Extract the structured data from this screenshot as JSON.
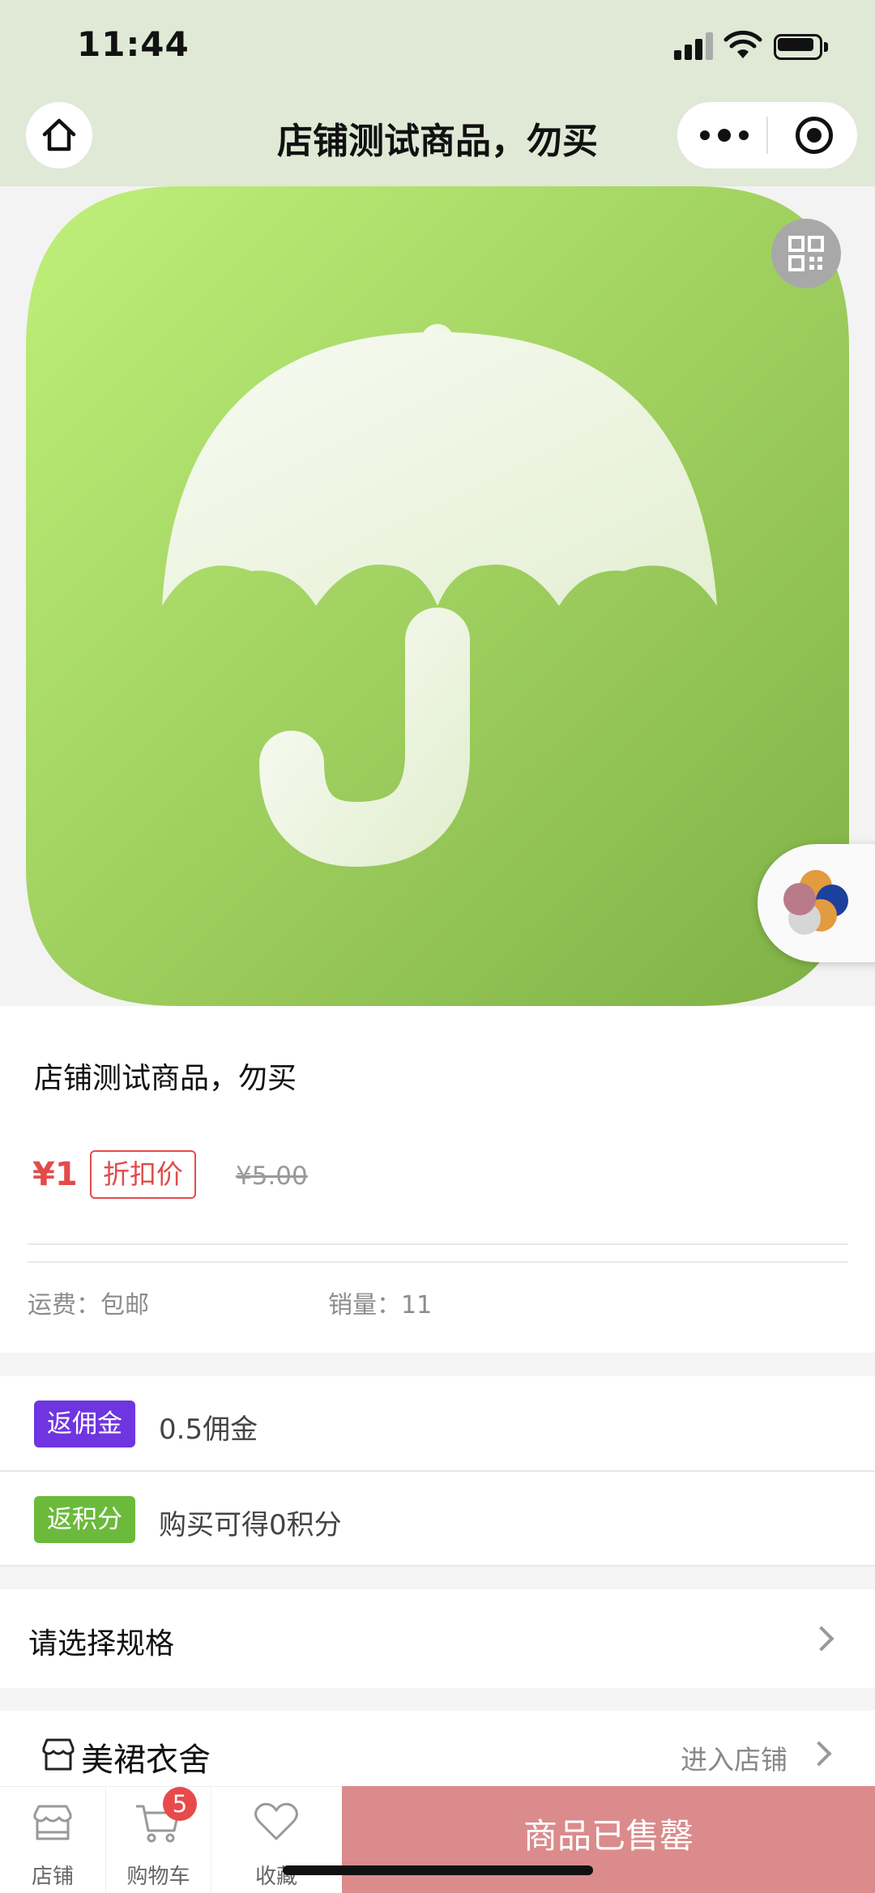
{
  "status_bar": {
    "time": "11:44"
  },
  "nav": {
    "title": "店铺测试商品，勿买"
  },
  "product": {
    "name": "店铺测试商品，勿买",
    "price": "¥1",
    "discount_label": "折扣价",
    "original_price": "¥5.00",
    "shipping": "运费：包邮",
    "sales": "销量：11"
  },
  "rebates": [
    {
      "tag": "返佣金",
      "text": "0.5佣金",
      "color": "#6f35e0"
    },
    {
      "tag": "返积分",
      "text": "购买可得0积分",
      "color": "#6cba3c"
    }
  ],
  "spec": {
    "label": "请选择规格"
  },
  "shop": {
    "name": "美裙衣舍",
    "enter_label": "进入店铺"
  },
  "bottom_bar": {
    "tabs": [
      {
        "label": "店铺",
        "icon": "store-icon"
      },
      {
        "label": "购物车",
        "icon": "cart-icon",
        "badge": "5"
      },
      {
        "label": "收藏",
        "icon": "heart-icon"
      }
    ],
    "sold_out_label": "商品已售罄"
  },
  "colors": {
    "header_bg": "#dfe9d6",
    "price_red": "#e24b4b",
    "sold_out_bg": "#db8b8b",
    "image_green": "#9ccb5c"
  }
}
